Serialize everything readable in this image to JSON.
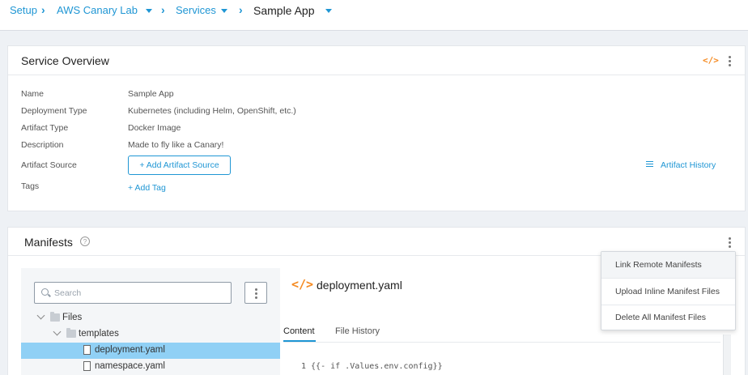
{
  "breadcrumb": {
    "items": [
      {
        "label": "Setup"
      },
      {
        "label": "AWS Canary Lab"
      },
      {
        "label": "Services"
      },
      {
        "label": "Sample App"
      }
    ]
  },
  "overview": {
    "title": "Service Overview",
    "fields": [
      {
        "label": "Name",
        "value": "Sample App"
      },
      {
        "label": "Deployment Type",
        "value": "Kubernetes (including Helm, OpenShift, etc.)"
      },
      {
        "label": "Artifact Type",
        "value": "Docker Image"
      },
      {
        "label": "Description",
        "value": "Made to fly like a Canary!"
      }
    ],
    "artifact_source_label": "Artifact Source",
    "add_artifact_source": "+ Add Artifact Source",
    "artifact_history": "Artifact History",
    "tags_label": "Tags",
    "add_tag": "+ Add Tag"
  },
  "manifests": {
    "title": "Manifests",
    "help": "?",
    "search": {
      "placeholder": "Search"
    },
    "tree": [
      {
        "label": "Files",
        "kind": "folder"
      },
      {
        "label": "templates",
        "kind": "folder"
      },
      {
        "label": "deployment.yaml",
        "kind": "file",
        "selected": true
      },
      {
        "label": "namespace.yaml",
        "kind": "file"
      }
    ],
    "file_title": "deployment.yaml",
    "tabs": [
      {
        "label": "Content",
        "active": true
      },
      {
        "label": "File History",
        "active": false
      }
    ],
    "code_first_line": "1  {{- if .Values.env.config}}"
  },
  "menu": {
    "items": [
      {
        "label": "Link Remote Manifests"
      },
      {
        "label": "Upload Inline Manifest Files"
      },
      {
        "label": "Delete All Manifest Files"
      }
    ]
  },
  "icons": {
    "code": "</>",
    "kebab": "kebab-icon"
  },
  "colors": {
    "accent": "#1f96d4",
    "code_icon": "#f5891f",
    "selected_row": "#90d0f5",
    "background": "#eef1f5"
  }
}
